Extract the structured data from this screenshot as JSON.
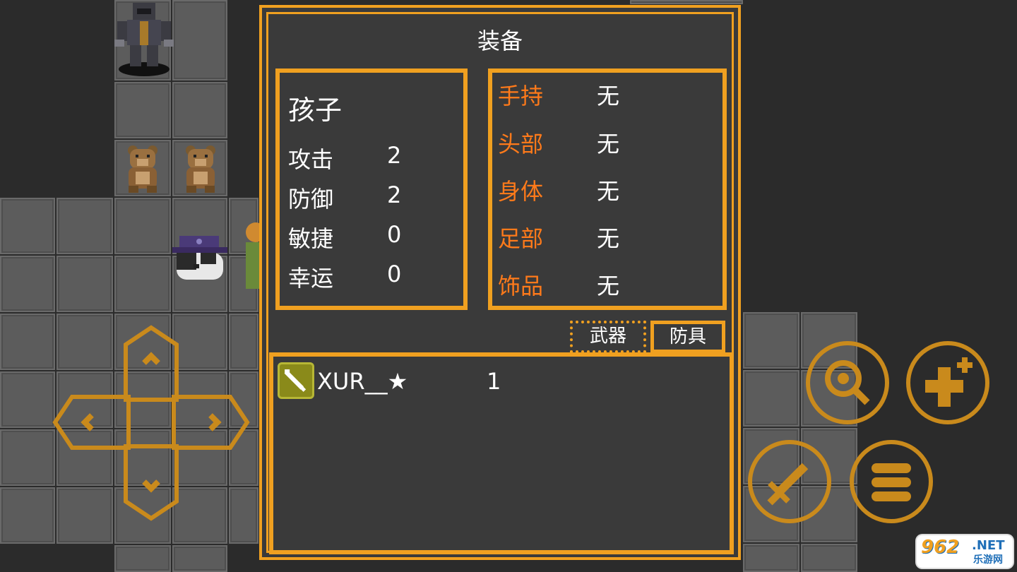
{
  "panel": {
    "title": "装备",
    "character": {
      "name": "孩子",
      "stats": [
        {
          "label": "攻击",
          "value": "2"
        },
        {
          "label": "防御",
          "value": "2"
        },
        {
          "label": "敏捷",
          "value": "0"
        },
        {
          "label": "幸运",
          "value": "0"
        }
      ]
    },
    "slots": [
      {
        "label": "手持",
        "value": "无"
      },
      {
        "label": "头部",
        "value": "无"
      },
      {
        "label": "身体",
        "value": "无"
      },
      {
        "label": "足部",
        "value": "无"
      },
      {
        "label": "饰品",
        "value": "无"
      }
    ],
    "tabs": {
      "weapon": "武器",
      "armor": "防具"
    },
    "items": [
      {
        "name": "XUR__★",
        "count": "1",
        "icon": "gun-icon"
      }
    ]
  },
  "controls": {
    "dpad": [
      "up-arrow-icon",
      "down-arrow-icon",
      "left-arrow-icon",
      "right-arrow-icon"
    ],
    "buttons": [
      "search-icon",
      "add-icon",
      "sword-icon",
      "menu-icon"
    ]
  },
  "watermark": {
    "logo": "962",
    "domain": ".NET",
    "cn": "乐游网"
  },
  "colors": {
    "accent": "#f0a020",
    "slot_label": "#ff7a1a",
    "panel_bg": "#3a3a3a"
  }
}
